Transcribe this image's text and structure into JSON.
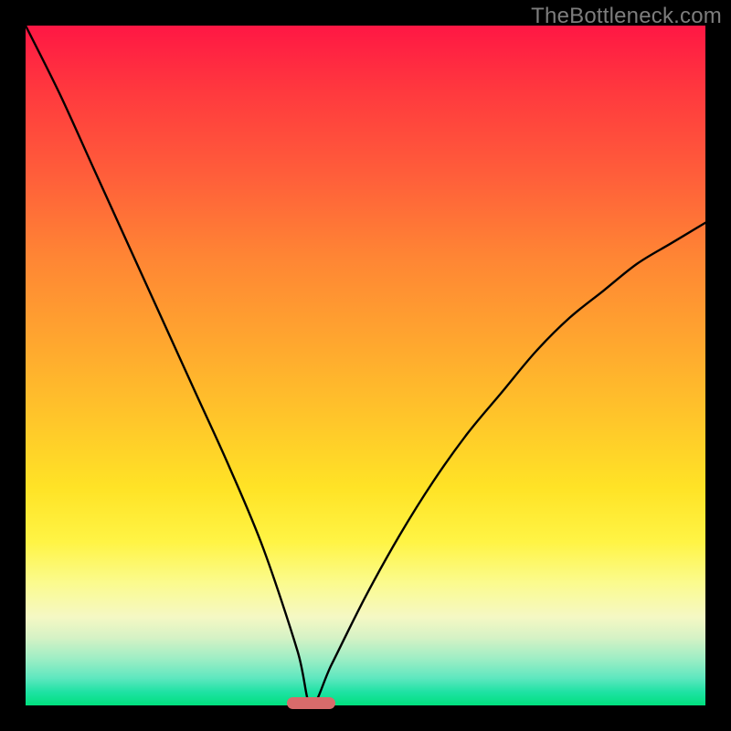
{
  "watermark": "TheBottleneck.com",
  "chart_data": {
    "type": "line",
    "title": "",
    "xlabel": "",
    "ylabel": "",
    "xlim": [
      0,
      100
    ],
    "ylim": [
      0,
      100
    ],
    "gradient_meaning": "bottleneck severity (top=high, bottom=low)",
    "minimum_x": 42,
    "marker": {
      "x_center": 42,
      "width_pct": 7,
      "color": "#d86b6b"
    },
    "series": [
      {
        "name": "bottleneck-curve",
        "x": [
          0,
          5,
          10,
          15,
          20,
          25,
          30,
          35,
          40,
          42,
          45,
          50,
          55,
          60,
          65,
          70,
          75,
          80,
          85,
          90,
          95,
          100
        ],
        "y": [
          100,
          90,
          79,
          68,
          57,
          46,
          35,
          23,
          8,
          0,
          6,
          16,
          25,
          33,
          40,
          46,
          52,
          57,
          61,
          65,
          68,
          71
        ]
      }
    ]
  }
}
